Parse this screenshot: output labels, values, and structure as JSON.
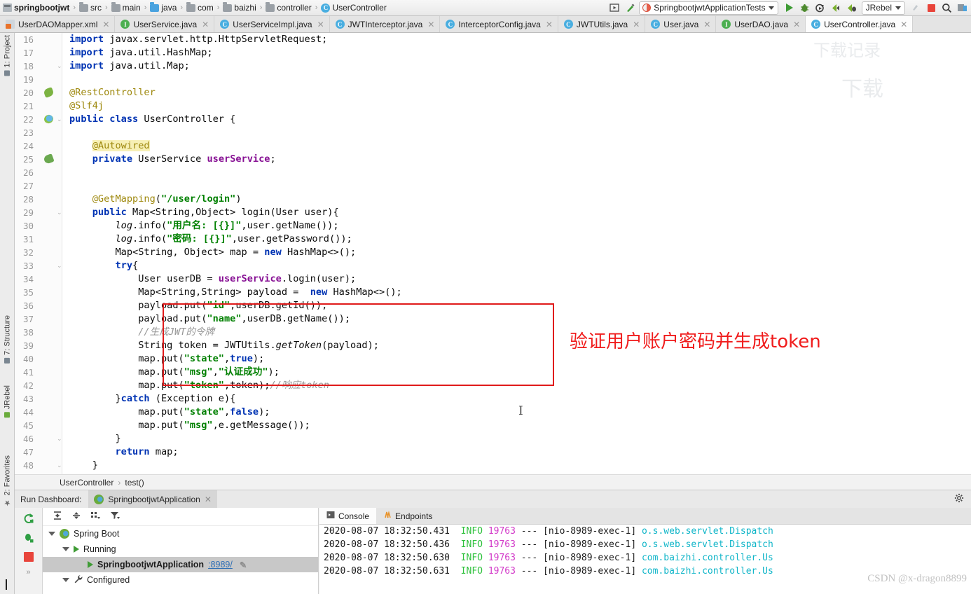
{
  "breadcrumb": {
    "items": [
      {
        "label": "springbootjwt",
        "icon": "module-icon"
      },
      {
        "label": "src",
        "icon": "folder-icon"
      },
      {
        "label": "main",
        "icon": "folder-icon"
      },
      {
        "label": "java",
        "icon": "folder-blue-icon"
      },
      {
        "label": "com",
        "icon": "folder-icon"
      },
      {
        "label": "baizhi",
        "icon": "folder-icon"
      },
      {
        "label": "controller",
        "icon": "folder-icon"
      },
      {
        "label": "UserController",
        "icon": "class-icon"
      }
    ]
  },
  "toolbar": {
    "run_config": "SpringbootjwtApplicationTests",
    "jrebel_label": "JRebel",
    "icons": [
      "run-with-coverage-icon",
      "build-icon",
      "run-icon",
      "debug-icon",
      "run-with-profiler-icon",
      "jrebel-run-icon",
      "jrebel-debug-icon",
      "update-icon",
      "stop-icon",
      "search-everywhere-icon",
      "settings-icon"
    ]
  },
  "editor_tabs": [
    {
      "label": "UserDAOMapper.xml",
      "icon": "xml-icon",
      "active": false
    },
    {
      "label": "UserService.java",
      "icon": "interface-icon",
      "active": false
    },
    {
      "label": "UserServiceImpl.java",
      "icon": "class-icon",
      "active": false
    },
    {
      "label": "JWTInterceptor.java",
      "icon": "class-icon",
      "active": false
    },
    {
      "label": "InterceptorConfig.java",
      "icon": "class-icon",
      "active": false
    },
    {
      "label": "JWTUtils.java",
      "icon": "class-icon",
      "active": false
    },
    {
      "label": "User.java",
      "icon": "class-icon",
      "active": false
    },
    {
      "label": "UserDAO.java",
      "icon": "interface-icon",
      "active": false
    },
    {
      "label": "UserController.java",
      "icon": "class-icon",
      "active": true
    }
  ],
  "left_strip": {
    "project": "1: Project",
    "structure": "7: Structure",
    "jrebel": "JRebel",
    "favorites": "2: Favorites"
  },
  "code": {
    "first_line": 16,
    "lines": [
      {
        "n": 16,
        "html": "<span class=\"kw\">import</span> javax.servlet.http.HttpServletRequest;"
      },
      {
        "n": 17,
        "html": "<span class=\"kw\">import</span> java.util.HashMap;"
      },
      {
        "n": 18,
        "html": "<span class=\"kw\">import</span> java.util.Map;"
      },
      {
        "n": 19,
        "html": ""
      },
      {
        "n": 20,
        "html": "<span class=\"ann\">@RestController</span>"
      },
      {
        "n": 21,
        "html": "<span class=\"ann\">@Slf4j</span>"
      },
      {
        "n": 22,
        "html": "<span class=\"kw\">public class</span> UserController {"
      },
      {
        "n": 23,
        "html": ""
      },
      {
        "n": 24,
        "html": "    <span class=\"ann hl\">@Autowired</span>"
      },
      {
        "n": 25,
        "html": "    <span class=\"kw\">private</span> UserService <span class=\"fld\">userService</span>;"
      },
      {
        "n": 26,
        "html": ""
      },
      {
        "n": 27,
        "html": ""
      },
      {
        "n": 28,
        "html": "    <span class=\"ann\">@GetMapping</span>(<span class=\"str\">\"/user/login\"</span>)"
      },
      {
        "n": 29,
        "html": "    <span class=\"kw\">public</span> Map&lt;String,Object&gt; login(User user){"
      },
      {
        "n": 30,
        "html": "        <span class=\"stat\">log</span>.info(<span class=\"str\">\"用户名: [{}]\"</span>,user.getName());"
      },
      {
        "n": 31,
        "html": "        <span class=\"stat\">log</span>.info(<span class=\"str\">\"密码: [{}]\"</span>,user.getPassword());"
      },
      {
        "n": 32,
        "html": "        Map&lt;String, Object&gt; map = <span class=\"kw\">new</span> HashMap&lt;&gt;();"
      },
      {
        "n": 33,
        "html": "        <span class=\"kw\">try</span>{"
      },
      {
        "n": 34,
        "html": "            User userDB = <span class=\"fld\">userService</span>.login(user);"
      },
      {
        "n": 35,
        "html": "            Map&lt;String,String&gt; payload =  <span class=\"kw\">new</span> HashMap&lt;&gt;();"
      },
      {
        "n": 36,
        "html": "            payload.put(<span class=\"str\">\"id\"</span>,userDB.getId());"
      },
      {
        "n": 37,
        "html": "            payload.put(<span class=\"str\">\"name\"</span>,userDB.getName());"
      },
      {
        "n": 38,
        "html": "            <span class=\"cmt\">//生成JWT的令牌</span>"
      },
      {
        "n": 39,
        "html": "            String token = JWTUtils.<span class=\"mth\">getToken</span>(payload);"
      },
      {
        "n": 40,
        "html": "            map.put(<span class=\"str\">\"state\"</span>,<span class=\"kw\">true</span>);"
      },
      {
        "n": 41,
        "html": "            map.put(<span class=\"str\">\"msg\"</span>,<span class=\"str\">\"认证成功\"</span>);"
      },
      {
        "n": 42,
        "html": "            map.put(<span class=\"str\">\"token\"</span>,token);<span class=\"cmt\">//响应token</span>"
      },
      {
        "n": 43,
        "html": "        }<span class=\"kw\">catch</span> (Exception e){"
      },
      {
        "n": 44,
        "html": "            map.put(<span class=\"str\">\"state\"</span>,<span class=\"kw\">false</span>);"
      },
      {
        "n": 45,
        "html": "            map.put(<span class=\"str\">\"msg\"</span>,e.getMessage());"
      },
      {
        "n": 46,
        "html": "        }"
      },
      {
        "n": 47,
        "html": "        <span class=\"kw\">return</span> map;"
      },
      {
        "n": 48,
        "html": "    }"
      },
      {
        "n": 49,
        "html": ""
      }
    ],
    "annotation": "验证用户账户密码并生成token",
    "annotation_color": "#f01c1c",
    "highlight_box_color": "#e01b1b"
  },
  "editor_breadcrumb": {
    "class": "UserController",
    "member": "test()"
  },
  "run_dashboard": {
    "title": "Run Dashboard:",
    "tab_label": "SpringbootjwtApplication",
    "tree": [
      {
        "label": "Spring Boot",
        "icon": "spring-icon",
        "depth": 0,
        "selected": false
      },
      {
        "label": "Running",
        "icon": "run-icon",
        "depth": 1,
        "selected": false
      },
      {
        "label": "SpringbootjwtApplication",
        "port": ":8989/",
        "icon": "run-icon",
        "depth": 2,
        "selected": true
      },
      {
        "label": "Configured",
        "icon": "wrench-icon",
        "depth": 1,
        "selected": false
      }
    ],
    "toolbar_icons": [
      "rerun-icon",
      "debug-icon",
      "stop-icon",
      "expand-icon"
    ],
    "tree_toolbar_icons": [
      "expand-all-icon",
      "collapse-all-icon",
      "group-icon",
      "filter-icon"
    ]
  },
  "console": {
    "tabs": [
      {
        "label": "Console",
        "icon": "console-icon",
        "active": true
      },
      {
        "label": "Endpoints",
        "icon": "endpoints-icon",
        "active": false
      }
    ],
    "lines": [
      {
        "ts": "2020-08-07 18:32:50.431",
        "level": "INFO",
        "pid": "19763",
        "dashes": "---",
        "thread": "[nio-8989-exec-1]",
        "cls": "o.s.web.servlet.Dispatch"
      },
      {
        "ts": "2020-08-07 18:32:50.436",
        "level": "INFO",
        "pid": "19763",
        "dashes": "---",
        "thread": "[nio-8989-exec-1]",
        "cls": "o.s.web.servlet.Dispatch"
      },
      {
        "ts": "2020-08-07 18:32:50.630",
        "level": "INFO",
        "pid": "19763",
        "dashes": "---",
        "thread": "[nio-8989-exec-1]",
        "cls": "com.baizhi.controller.Us"
      },
      {
        "ts": "2020-08-07 18:32:50.631",
        "level": "INFO",
        "pid": "19763",
        "dashes": "---",
        "thread": "[nio-8989-exec-1]",
        "cls": "com.baizhi.controller.Us"
      }
    ]
  },
  "watermark": "CSDN @x-dragon8899"
}
